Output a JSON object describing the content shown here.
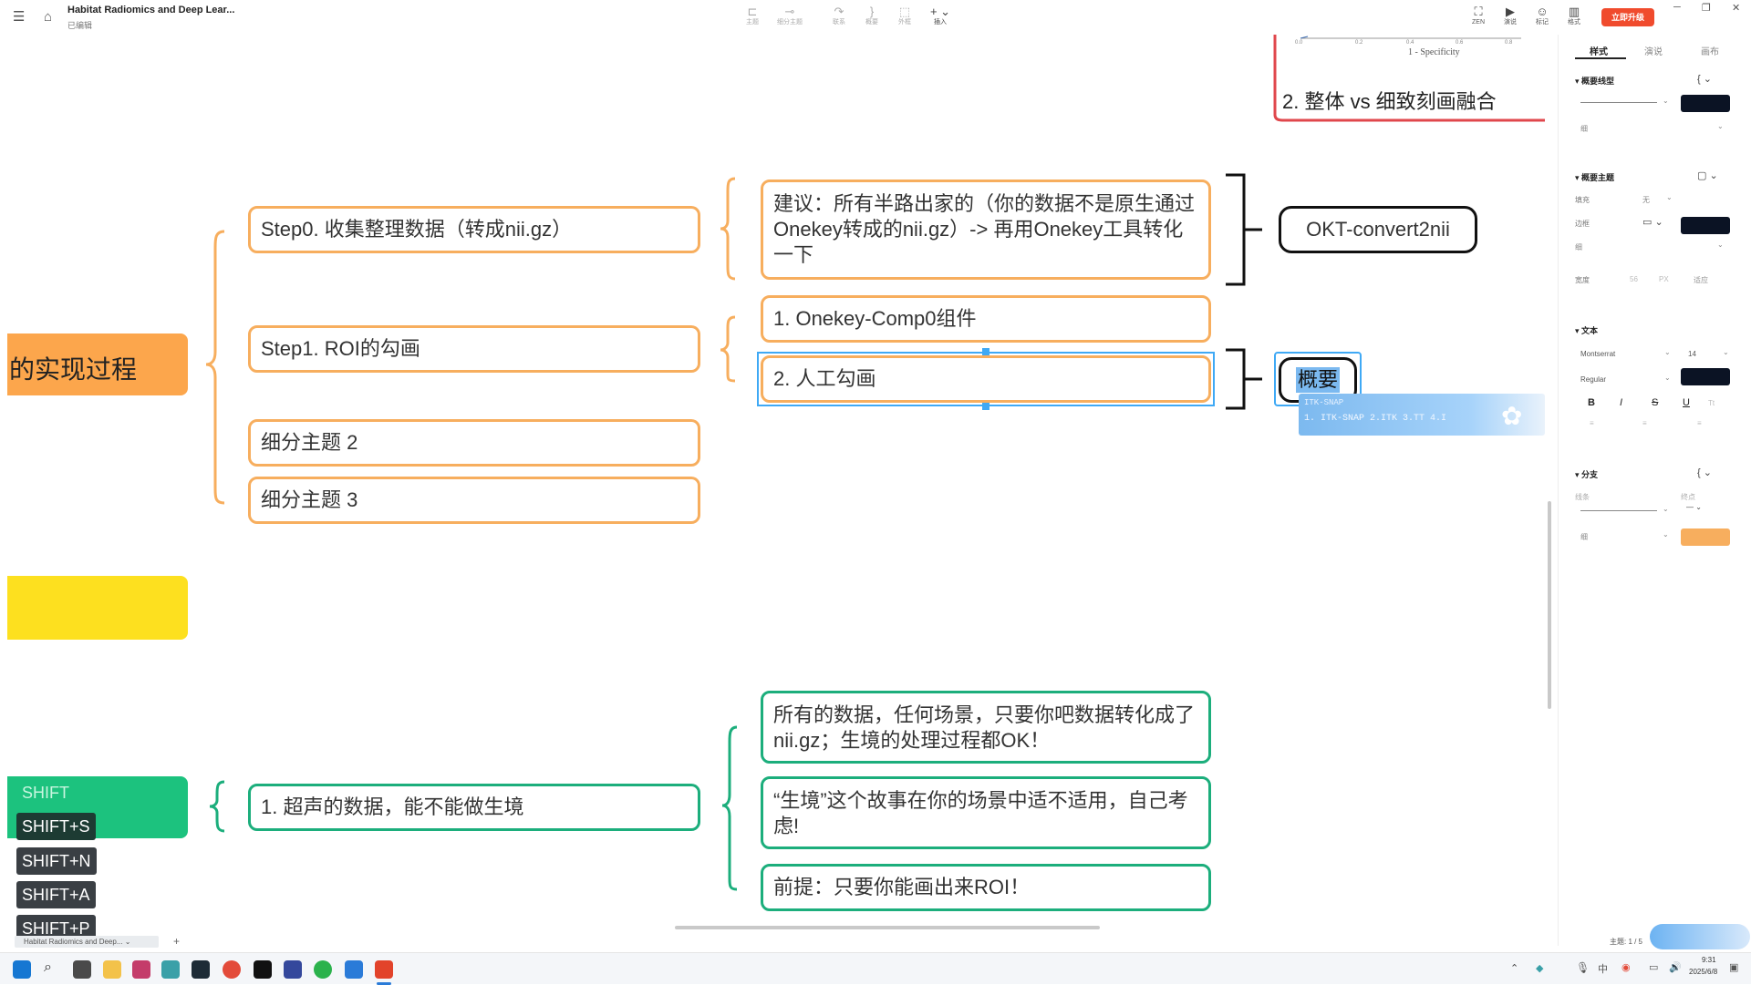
{
  "header": {
    "title": "Habitat Radiomics and Deep Lear...",
    "status": "已编辑",
    "tools": [
      {
        "icon": "topic-icon",
        "label": "主题"
      },
      {
        "icon": "subtopic-icon",
        "label": "细分主题"
      },
      {
        "icon": "relation-icon",
        "label": "联系"
      },
      {
        "icon": "summary-icon",
        "label": "概要"
      },
      {
        "icon": "boundary-icon",
        "label": "外框"
      },
      {
        "icon": "insert-icon",
        "label": "插入"
      }
    ],
    "right_tools": [
      {
        "icon": "zen-icon",
        "label": "ZEN"
      },
      {
        "icon": "present-icon",
        "label": "演说"
      },
      {
        "icon": "marker-icon",
        "label": "标记"
      },
      {
        "icon": "format-icon",
        "label": "格式"
      }
    ],
    "upgrade_label": "立即升级"
  },
  "canvas": {
    "roc_xlabel": "1 - Specificity",
    "roc_ticks": [
      "0.0",
      "0.2",
      "0.4",
      "0.6",
      "0.8"
    ],
    "top_node": "2. 整体 vs 细致刻画融合",
    "root_label": "的实现过程",
    "steps": [
      "Step0. 收集整理数据（转成nii.gz）",
      "Step1. ROI的勾画",
      "细分主题 2",
      "细分主题 3"
    ],
    "step0_child": "建议：所有半路出家的（你的数据不是原生通过Onekey转成的nii.gz）-> 再用Onekey工具转化一下",
    "step0_summary": "OKT-convert2nii",
    "step1_children": [
      "1. Onekey-Comp0组件",
      "2. 人工勾画"
    ],
    "step1_summary": "概要",
    "green_topic": "1. 超声的数据，能不能做生境",
    "green_children": [
      "所有的数据，任何场景，只要你吧数据转化成了nii.gz；生境的处理过程都OK！",
      "“生境”这个故事在你的场景中适不适用，自己考虑!",
      "前提：只要你能画出来ROI！"
    ],
    "tooltip": {
      "title": "ITK-SNAP",
      "items": "1. ITK-SNAP   2.ITK   3.TT   4.I"
    }
  },
  "keys": [
    "SHIFT",
    "SHIFT+S",
    "SHIFT+N",
    "SHIFT+A",
    "SHIFT+P"
  ],
  "panel": {
    "tabs": [
      "样式",
      "演说",
      "画布"
    ],
    "summary_line": {
      "title": "概要线型",
      "thickness": "细"
    },
    "summary_topic": {
      "title": "概要主题",
      "fill_label": "填充",
      "fill_value": "无",
      "border_label": "边框",
      "thickness": "细",
      "width_label": "宽度",
      "width_value": "56",
      "width_unit": "PX",
      "width_fit": "适应"
    },
    "text": {
      "title": "文本",
      "font": "Montserrat",
      "size": "14",
      "weight": "Regular",
      "bold": "B",
      "italic": "I",
      "strike": "S",
      "underline": "U",
      "tt": "Tt"
    },
    "branch": {
      "title": "分支",
      "line_label": "线条",
      "end_label": "终点",
      "thickness": "细"
    },
    "colors": {
      "summary_line": "#0b1324",
      "border": "#0b1324",
      "text": "#0b1324",
      "branch": "#f7ae5e"
    },
    "topic_count": "主题: 1 / 5"
  },
  "taskbar": {
    "tab_label": "Habitat Radiomics and Deep...",
    "time": "9:31",
    "date": "2025/6/8"
  },
  "colors": {
    "orange": "#f7ae5e",
    "green": "#1cae7c",
    "root_orange": "#fca64c",
    "yellow": "#fde01f",
    "selection": "#3fa9f5",
    "upgrade": "#f04b2d",
    "top_red": "#e0474c"
  }
}
